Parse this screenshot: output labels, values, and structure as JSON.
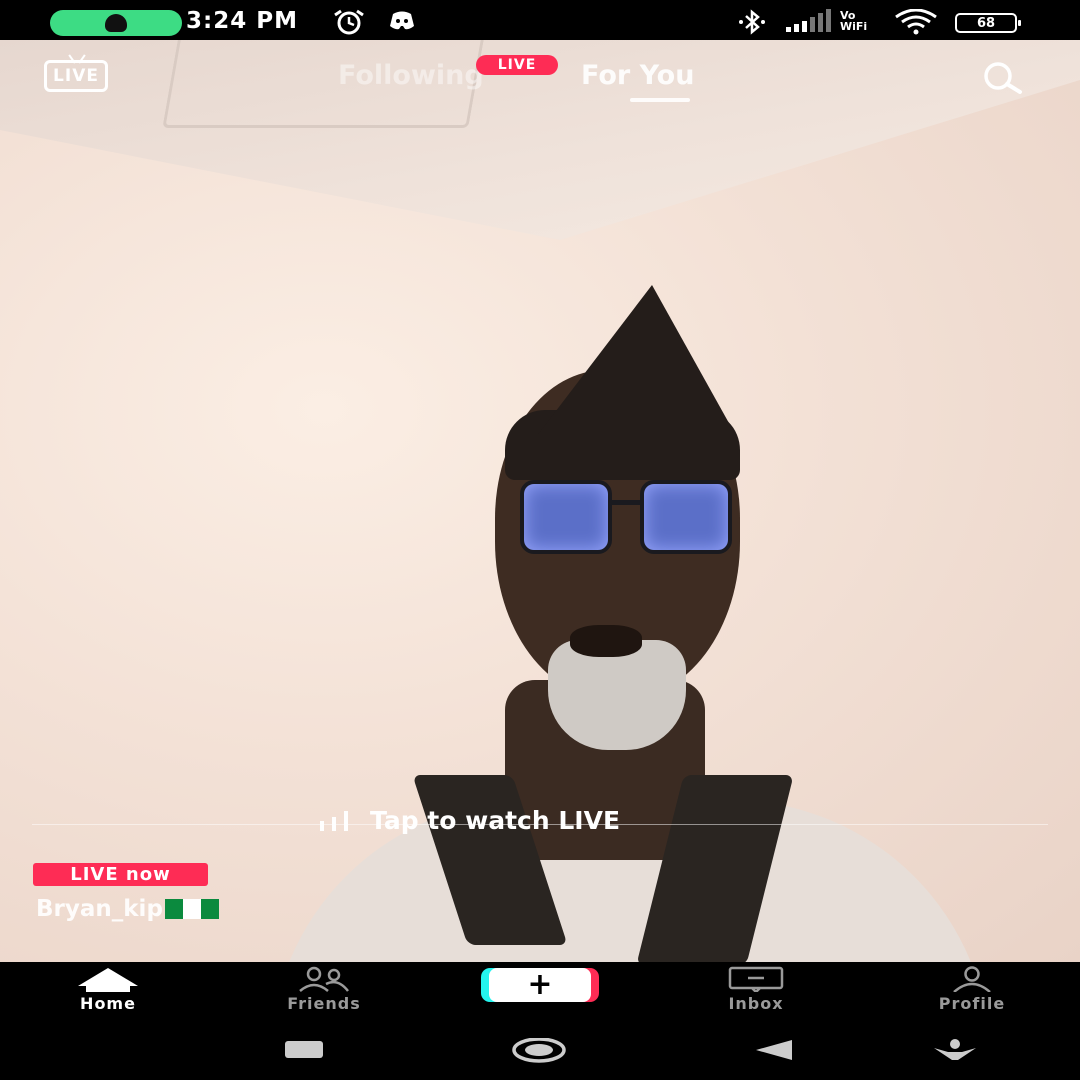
{
  "status_bar": {
    "time": "3:24 PM",
    "battery": "68",
    "network": "VoWiFi",
    "icons": [
      "call-active-icon",
      "alarm-icon",
      "discord-icon",
      "bluetooth-icon",
      "signal-icon",
      "wifi-icon",
      "battery-icon"
    ]
  },
  "top_nav": {
    "live_icon_label": "LIVE",
    "tabs": [
      {
        "label": "Following",
        "active": false
      },
      {
        "label": "For You",
        "active": true
      }
    ],
    "following_badge": "LIVE",
    "search_icon": "search-icon"
  },
  "stream": {
    "tap_to_watch": "Tap to watch LIVE",
    "live_now_badge": "LIVE now",
    "username": "Bryan_kip",
    "flag": "nigeria-flag-icon"
  },
  "bottom_nav": {
    "items": [
      {
        "label": "Home",
        "icon": "home-icon",
        "active": true
      },
      {
        "label": "Friends",
        "icon": "friends-icon",
        "active": false
      },
      {
        "label": "+",
        "icon": "create-icon",
        "active": false
      },
      {
        "label": "Inbox",
        "icon": "inbox-icon",
        "active": false
      },
      {
        "label": "Profile",
        "icon": "profile-icon",
        "active": false
      }
    ]
  },
  "system_nav": [
    "recents-button",
    "home-button",
    "back-button",
    "assistant-button"
  ],
  "colors": {
    "accent_pink": "#fe2c55",
    "accent_cyan": "#25f4ee",
    "call_green": "#3ddc84",
    "background": "#000000"
  }
}
